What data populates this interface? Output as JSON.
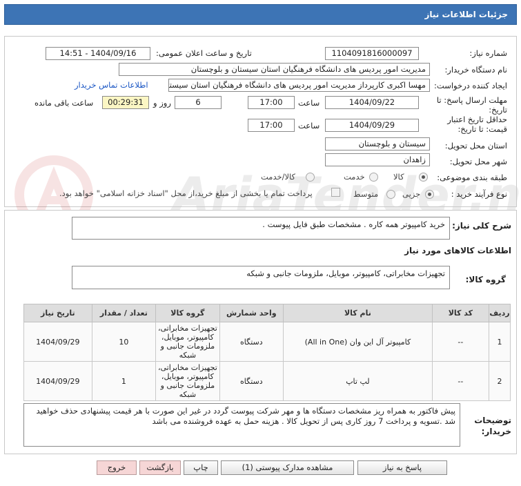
{
  "header": {
    "title": "جزئیات اطلاعات نیاز"
  },
  "form": {
    "need_number_label": "شماره نیاز:",
    "need_number": "1104091816000097",
    "announce_label": "تاریخ و ساعت اعلان عمومی:",
    "announce_value": "1404/09/16 - 14:51",
    "buyer_org_label": "نام دستگاه خریدار:",
    "buyer_org": "مدیریت امور پردیس های دانشگاه فرهنگیان استان سیستان و بلوچستان",
    "requester_label": "ایجاد کننده درخواست:",
    "requester": "مهسا اکبری کارپرداز مدیریت امور پردیس های دانشگاه فرهنگیان استان سیستان",
    "contact_link": "اطلاعات تماس خریدار",
    "deadline_label_1": "مهلت ارسال پاسخ: تا",
    "deadline_label_2": "تاریخ:",
    "deadline_date": "1404/09/22",
    "time_label": "ساعت",
    "deadline_time": "17:00",
    "days": "6",
    "days_label": "روز و",
    "remaining_time": "00:29:31",
    "remaining_label": "ساعت باقی مانده",
    "validity_label_1": "حداقل تاریخ اعتبار",
    "validity_label_2": "قیمت: تا تاریخ:",
    "validity_date": "1404/09/29",
    "validity_time": "17:00",
    "province_label": "استان محل تحویل:",
    "province": "سیستان و بلوچستان",
    "city_label": "شهر محل تحویل:",
    "city": "زاهدان",
    "category_label": "طبقه بندی موضوعی:",
    "category_options": [
      "کالا",
      "خدمت",
      "کالا/خدمت"
    ],
    "category_selected": "کالا",
    "process_label": "نوع فرآیند خرید :",
    "process_options": [
      "جزیی",
      "متوسط"
    ],
    "process_selected": "جزیی",
    "payment_note": "پرداخت تمام یا بخشی از مبلغ خرید،از محل \"اسناد خزانه اسلامی\" خواهد بود."
  },
  "summary": {
    "label": "شرح کلی نیاز:",
    "text": "خرید  کامپیوتر همه کاره  .  مشخصات طبق فایل پیوست  ."
  },
  "goods": {
    "section_title": "اطلاعات کالاهای مورد نیاز",
    "group_label": "گروه کالا:",
    "group_value": "تجهیزات مخابراتی، کامپیوتر، موبایل، ملزومات جانبی و شبکه"
  },
  "table": {
    "headers": [
      "ردیف",
      "کد کالا",
      "نام کالا",
      "واحد شمارش",
      "گروه کالا",
      "تعداد / مقدار",
      "تاریخ نیاز"
    ],
    "rows": [
      {
        "row": "1",
        "code": "--",
        "name": "کامپیوتر آل این وان (All in One)",
        "unit": "دستگاه",
        "group": "تجهیزات مخابراتی، کامپیوتر، موبایل، ملزومات جانبی و شبکه",
        "qty": "10",
        "date": "1404/09/29"
      },
      {
        "row": "2",
        "code": "--",
        "name": "لپ تاپ",
        "unit": "دستگاه",
        "group": "تجهیزات مخابراتی، کامپیوتر، موبایل، ملزومات جانبی و شبکه",
        "qty": "1",
        "date": "1404/09/29"
      }
    ]
  },
  "notes": {
    "label_1": "توضیحات",
    "label_2": "خریدار:",
    "text": "پیش فاکتور به همراه ریز مشخصات دستگاه ها و مهر شرکت پیوست گردد در غیر این صورت با هر قیمت پیشنهادی حذف خواهید شد .تسویه و پرداخت 7 روز کاری  پس از تحویل کالا  . هزینه حمل به عهده فروشنده می باشد"
  },
  "buttons": {
    "reply": "پاسخ به نیاز",
    "attachments": "مشاهده مدارک پیوستی (1)",
    "print": "چاپ",
    "back": "بازگشت",
    "exit": "خروج"
  },
  "watermark": {
    "text": "AriaTender.neT"
  }
}
